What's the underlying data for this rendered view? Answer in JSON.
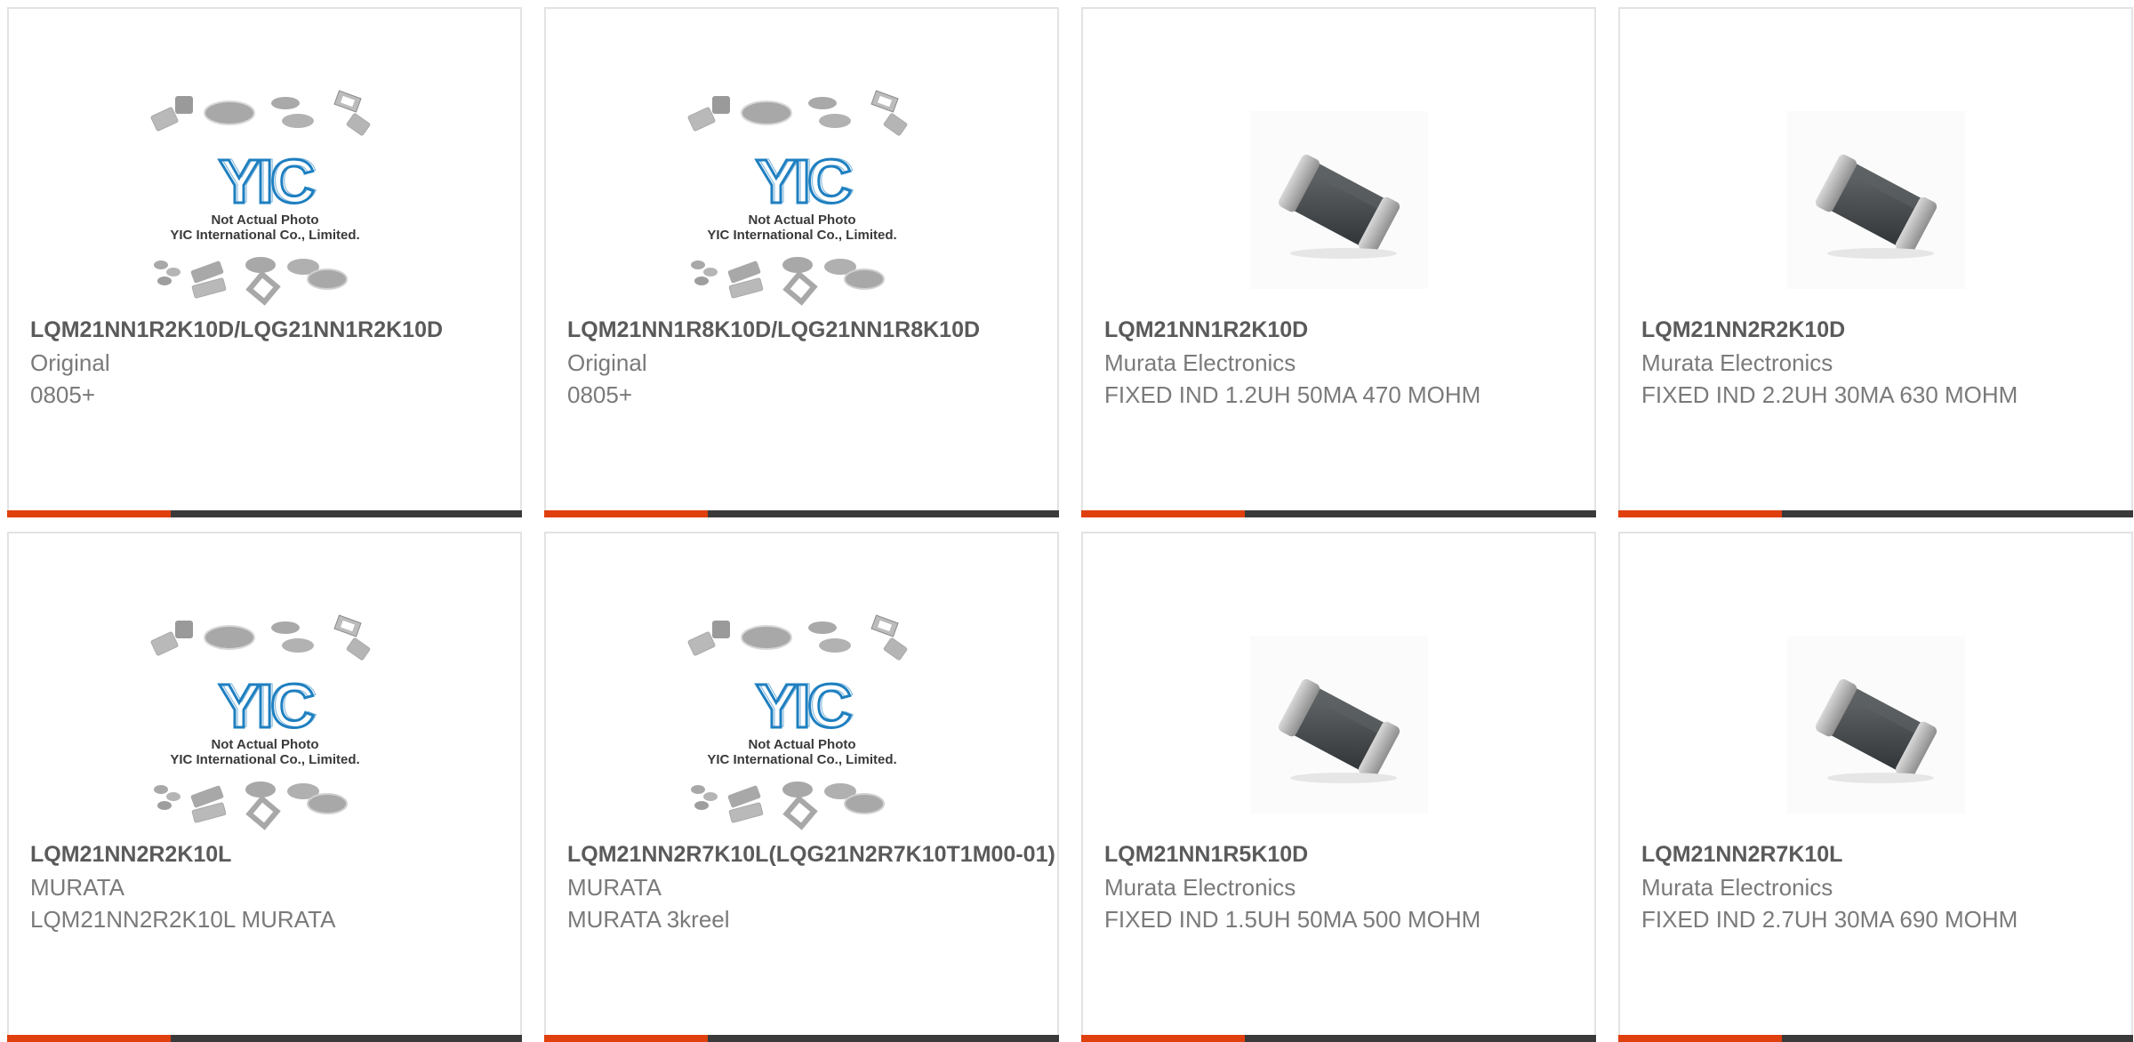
{
  "placeholder_image": {
    "caption_line1": "Not Actual Photo",
    "caption_line2": "YIC International Co., Limited.",
    "logo_text": "YIC"
  },
  "colors": {
    "accent": "#e0400e",
    "bar": "#3a3a3a",
    "border": "#e3e3e3",
    "logo_blue": "#1e7fc0"
  },
  "products": [
    {
      "part": "LQM21NN1R2K10D/LQG21NN1R2K10D",
      "line1": "Original",
      "line2": "0805+",
      "image": "placeholder"
    },
    {
      "part": "LQM21NN1R8K10D/LQG21NN1R8K10D",
      "line1": "Original",
      "line2": "0805+",
      "image": "placeholder"
    },
    {
      "part": "LQM21NN1R2K10D",
      "line1": "Murata Electronics",
      "line2": "FIXED IND 1.2UH 50MA 470 MOHM",
      "image": "chip-inductor"
    },
    {
      "part": "LQM21NN2R2K10D",
      "line1": "Murata Electronics",
      "line2": "FIXED IND 2.2UH 30MA 630 MOHM",
      "image": "chip-inductor"
    },
    {
      "part": "LQM21NN2R2K10L",
      "line1": "MURATA",
      "line2": "LQM21NN2R2K10L MURATA",
      "image": "placeholder"
    },
    {
      "part": "LQM21NN2R7K10L(LQG21N2R7K10T1M00-01)",
      "line1": "MURATA",
      "line2": "MURATA 3kreel",
      "image": "placeholder"
    },
    {
      "part": "LQM21NN1R5K10D",
      "line1": "Murata Electronics",
      "line2": "FIXED IND 1.5UH 50MA 500 MOHM",
      "image": "chip-inductor"
    },
    {
      "part": "LQM21NN2R7K10L",
      "line1": "Murata Electronics",
      "line2": "FIXED IND 2.7UH 30MA 690 MOHM",
      "image": "chip-inductor"
    }
  ]
}
